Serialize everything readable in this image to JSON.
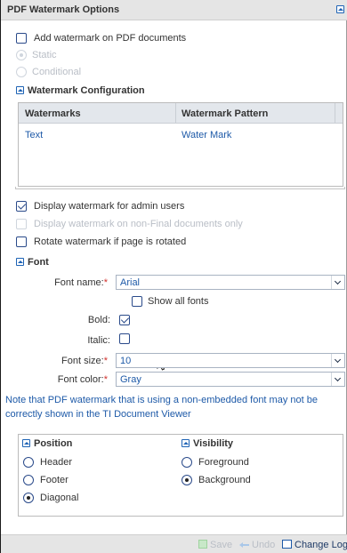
{
  "panel": {
    "title": "PDF Watermark Options"
  },
  "general": {
    "add_watermark_label": "Add watermark on PDF documents",
    "add_watermark_checked": false,
    "mode_static_label": "Static",
    "mode_conditional_label": "Conditional",
    "selected_mode": "Static"
  },
  "config": {
    "section_label": "Watermark Configuration",
    "columns": [
      "Watermarks",
      "Watermark Pattern"
    ],
    "rows": [
      {
        "watermark": "Text",
        "pattern": "Water Mark"
      }
    ]
  },
  "options": {
    "display_admin_label": "Display watermark for admin users",
    "display_admin_checked": true,
    "display_nonfinal_label": "Display watermark on non-Final documents only",
    "display_nonfinal_checked": false,
    "rotate_label": "Rotate watermark if page is rotated",
    "rotate_checked": false
  },
  "font": {
    "section_label": "Font",
    "name_label": "Font name:",
    "name_value": "Arial",
    "show_all_label": "Show all fonts",
    "show_all_checked": false,
    "bold_label": "Bold:",
    "bold_checked": true,
    "italic_label": "Italic:",
    "italic_checked": false,
    "size_label": "Font size:",
    "size_value": "10",
    "color_label": "Font color:",
    "color_value": "Gray",
    "required_mark": "*",
    "note": "Note that PDF watermark that is using a non-embedded font may not be correctly shown in the TI Document Viewer"
  },
  "position": {
    "section_label": "Position",
    "options": [
      "Header",
      "Footer",
      "Diagonal"
    ],
    "selected": "Diagonal"
  },
  "visibility": {
    "section_label": "Visibility",
    "options": [
      "Foreground",
      "Background"
    ],
    "selected": "Background"
  },
  "footer": {
    "save_label": "Save",
    "undo_label": "Undo",
    "changelog_label": "Change Log"
  },
  "colors": {
    "accent": "#1e5aa8",
    "required": "#d0312d",
    "header_bg": "#e5e5e5"
  }
}
